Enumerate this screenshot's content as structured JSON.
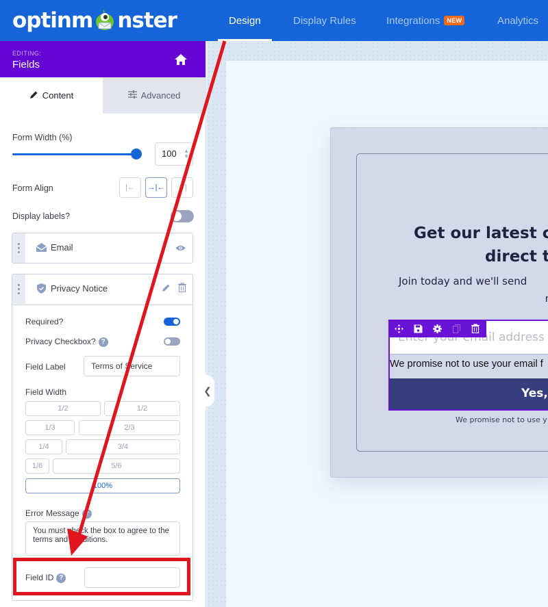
{
  "app": {
    "logo_text_before": "optinm",
    "logo_text_after": "nster"
  },
  "nav": {
    "items": [
      {
        "label": "Design",
        "active": true
      },
      {
        "label": "Display Rules",
        "active": false
      },
      {
        "label": "Integrations",
        "active": false,
        "badge": "NEW"
      },
      {
        "label": "Analytics",
        "active": false
      }
    ]
  },
  "sidebar": {
    "editing_label": "EDITING:",
    "editing_title": "Fields",
    "tabs": [
      {
        "label": "Content",
        "icon": "pencil-icon",
        "active": true
      },
      {
        "label": "Advanced",
        "icon": "sliders-icon",
        "active": false
      }
    ],
    "form_width": {
      "label": "Form Width (%)",
      "value": "100",
      "slider_percent": 100
    },
    "form_align": {
      "label": "Form Align",
      "options": [
        "left",
        "center",
        "right"
      ],
      "selected": "center"
    },
    "display_labels": {
      "label": "Display labels?",
      "enabled": false
    },
    "fields": [
      {
        "name": "Email",
        "icon": "envelope-icon",
        "actions": [
          "eye-icon"
        ]
      },
      {
        "name": "Privacy Notice",
        "icon": "shield-icon",
        "actions": [
          "pencil-icon",
          "trash-icon"
        ],
        "required": {
          "label": "Required?",
          "enabled": true
        },
        "privacy_checkbox": {
          "label": "Privacy Checkbox?",
          "enabled": false
        },
        "field_label": {
          "label": "Field Label",
          "value": "Terms of Service"
        },
        "field_width": {
          "label": "Field Width",
          "options": [
            [
              "1/2",
              "1/2"
            ],
            [
              "1/3",
              "2/3"
            ],
            [
              "1/4",
              "3/4"
            ],
            [
              "1/6",
              "5/6"
            ],
            [
              "100%"
            ]
          ],
          "selected": "100%"
        },
        "error_message": {
          "label": "Error Message",
          "value": "You must check the box to agree to the terms and conditions."
        },
        "field_id": {
          "label": "Field ID",
          "value": ""
        }
      }
    ]
  },
  "canvas": {
    "headline_line1": "Get our latest c",
    "headline_line2": "direct t",
    "subline": "Join today and we'll send",
    "subline2": "r",
    "email_placeholder": "Enter your email address h",
    "privacy_line": "We promise not to use your email f",
    "button_label": "Yes,",
    "footnote": "We promise not to use y",
    "toolbar_icons": [
      "move-icon",
      "save-icon",
      "gear-icon",
      "copy-icon",
      "trash-icon"
    ]
  },
  "colors": {
    "brand_blue": "#1565d8",
    "editing_purple": "#6405d3",
    "badge_orange": "#f26b1d",
    "annotation_red": "#e0161e",
    "button_navy": "#363f7d"
  }
}
